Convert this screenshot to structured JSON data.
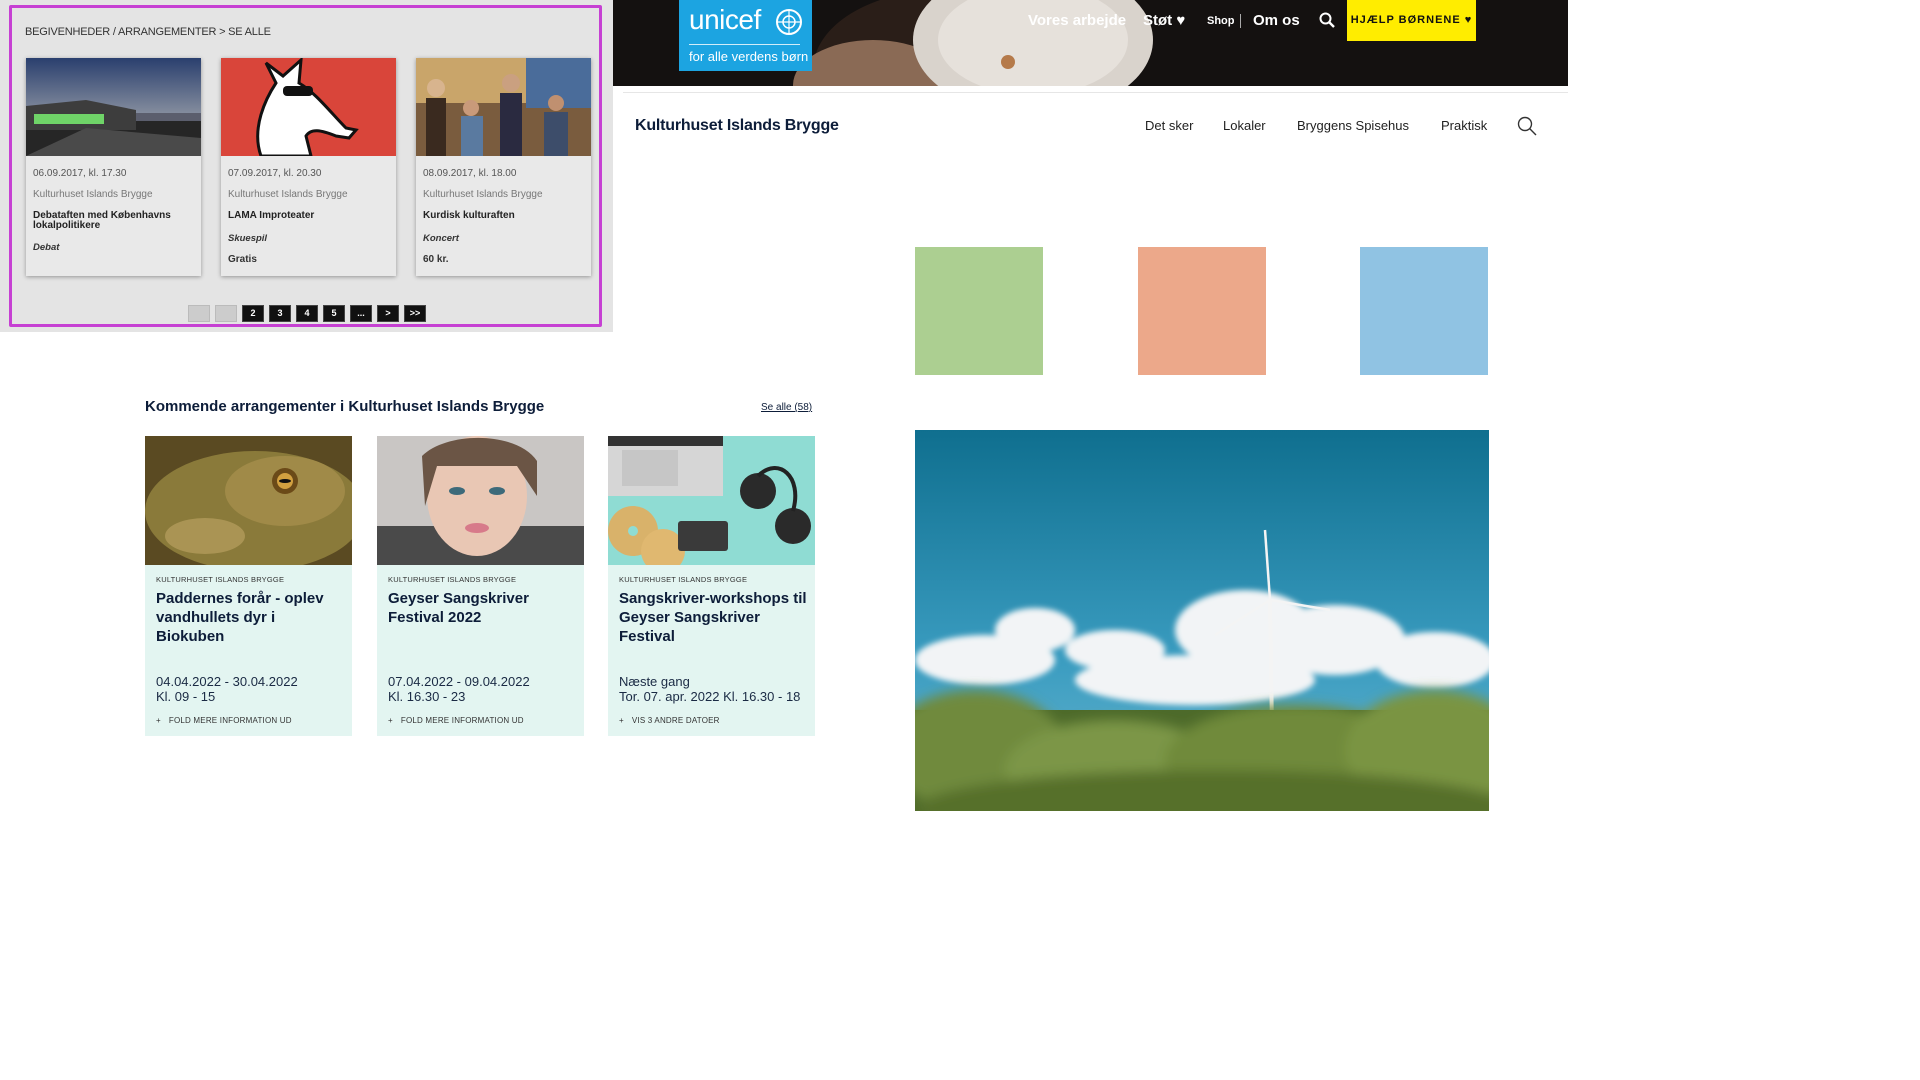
{
  "old_list": {
    "breadcrumb": "BEGIVENHEDER / ARRANGEMENTER > SE ALLE",
    "cards": [
      {
        "date": "06.09.2017, kl. 17.30",
        "venue": "Kulturhuset Islands Brygge",
        "title": "Debataften med Københavns lokalpolitikere",
        "category": "Debat",
        "price": ""
      },
      {
        "date": "07.09.2017, kl. 20.30",
        "venue": "Kulturhuset Islands Brygge",
        "title": "LAMA Improteater",
        "category": "Skuespil",
        "price": "Gratis"
      },
      {
        "date": "08.09.2017, kl. 18.00",
        "venue": "Kulturhuset Islands Brygge",
        "title": "Kurdisk kulturaften",
        "category": "Koncert",
        "price": "60 kr."
      }
    ],
    "pager": [
      "<",
      "1",
      "2",
      "3",
      "4",
      "5",
      "...",
      ">",
      ">>"
    ]
  },
  "unicef": {
    "logo_word": "unicef",
    "logo_tagline": "for alle verdens børn",
    "nav": [
      "Vores arbejde",
      "Støt ♥",
      "Shop",
      "Om os"
    ],
    "help_button": "HJÆLP BØRNENE ♥"
  },
  "kulturhus_nav": {
    "site_name": "Kulturhuset Islands Brygge",
    "items": [
      "Det sker",
      "Lokaler",
      "Bryggens Spisehus",
      "Praktisk"
    ]
  },
  "swatches": {
    "green": "#accf91",
    "salmon": "#eca88a",
    "blue": "#90c3e3"
  },
  "upcoming": {
    "title": "Kommende arrangementer i Kulturhuset Islands Brygge",
    "see_all": "Se alle (58)",
    "cards": [
      {
        "venue": "KULTURHUSET ISLANDS BRYGGE",
        "title": "Paddernes forår - oplev vandhullets dyr i Biokuben",
        "line1": "04.04.2022 - 30.04.2022",
        "line2": "Kl. 09 - 15",
        "more": "FOLD MERE INFORMATION UD"
      },
      {
        "venue": "KULTURHUSET ISLANDS BRYGGE",
        "title": "Geyser Sangskriver Festival 2022",
        "line1": "07.04.2022 - 09.04.2022",
        "line2": "Kl. 16.30 - 23",
        "more": "FOLD MERE INFORMATION UD"
      },
      {
        "venue": "KULTURHUSET ISLANDS BRYGGE",
        "title": "Sangskriver-workshops til Geyser Sangskriver Festival",
        "line1": "Næste gang",
        "line2": "Tor. 07. apr. 2022 Kl. 16.30 - 18",
        "more": "VIS 3 ANDRE DATOER"
      }
    ]
  }
}
